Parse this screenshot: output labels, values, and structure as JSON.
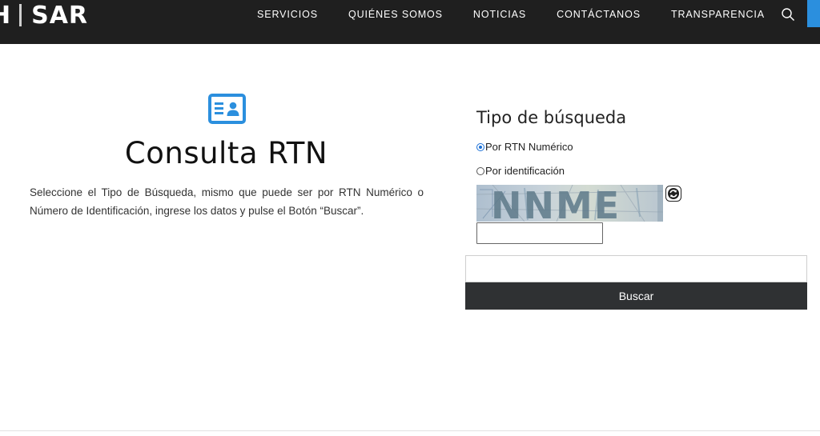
{
  "header": {
    "logo_left": "H",
    "logo_right": "SAR",
    "nav": [
      "SERVICIOS",
      "QUIÉNES SOMOS",
      "NOTICIAS",
      "CONTÁCTANOS",
      "TRANSPARENCIA"
    ],
    "search_icon": "search-icon",
    "colors": {
      "bar": "#1f1f1f",
      "accent": "#2b8fde"
    }
  },
  "intro": {
    "icon": "id-card-icon",
    "title": "Consulta RTN",
    "description": "Seleccione el Tipo de Búsqueda, mismo que puede ser por RTN Numérico o Número de Identificación, ingrese los datos y pulse el Botón “Buscar”."
  },
  "form": {
    "title": "Tipo de búsqueda",
    "options": [
      {
        "label": "Por RTN Numérico",
        "checked": true
      },
      {
        "label": "Por identificación",
        "checked": false
      }
    ],
    "captcha_text": "NNME",
    "refresh_icon": "refresh-icon",
    "captcha_value": "",
    "search_value": "",
    "submit_label": "Buscar",
    "colors": {
      "button": "#2f3133",
      "radio": "#1a6fd6"
    }
  }
}
